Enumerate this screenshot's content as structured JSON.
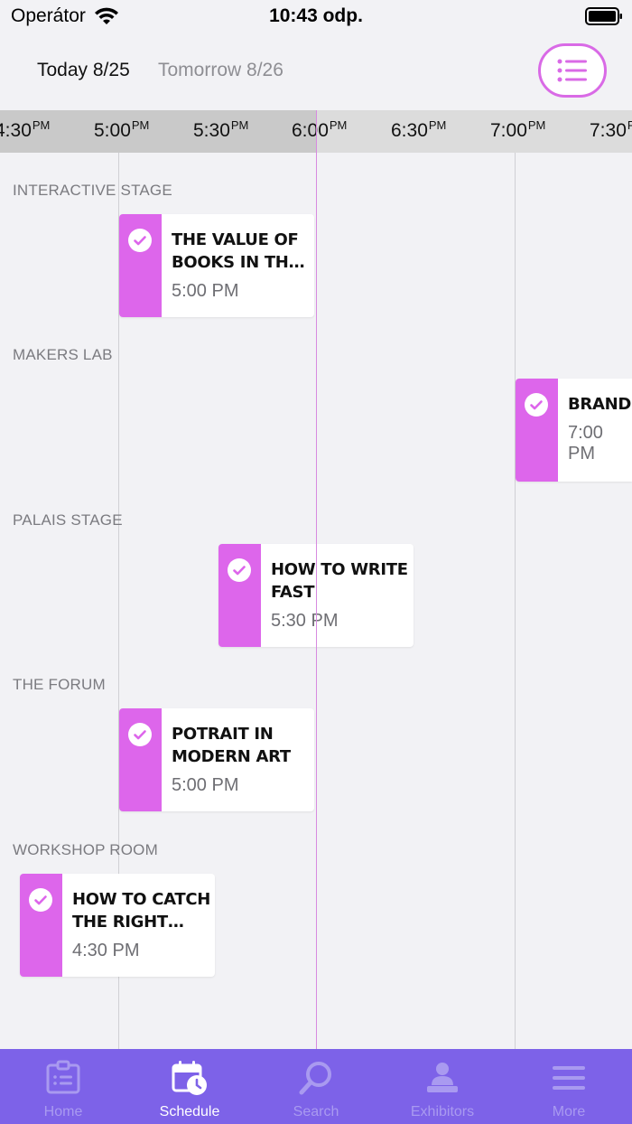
{
  "status_bar": {
    "carrier": "Operátor",
    "time": "10:43 odp."
  },
  "header": {
    "today_tab": "Today 8/25",
    "tomorrow_tab": "Tomorrow 8/26",
    "accent_color": "#d96ae6"
  },
  "timeline": {
    "labels": [
      {
        "time": "4:30",
        "suffix": "PM"
      },
      {
        "time": "5:00",
        "suffix": "PM"
      },
      {
        "time": "5:30",
        "suffix": "PM"
      },
      {
        "time": "6:00",
        "suffix": "PM"
      },
      {
        "time": "6:30",
        "suffix": "PM"
      },
      {
        "time": "7:00",
        "suffix": "PM"
      },
      {
        "time": "7:30",
        "suffix": "PM"
      }
    ]
  },
  "stages": [
    {
      "name": "INTERACTIVE STAGE"
    },
    {
      "name": "MAKERS LAB"
    },
    {
      "name": "PALAIS STAGE"
    },
    {
      "name": "THE FORUM"
    },
    {
      "name": "WORKSHOP ROOM"
    }
  ],
  "events": [
    {
      "title": "THE VALUE OF BOOKS IN THE DIGITAL AGE",
      "time": "5:00 PM",
      "stage": "INTERACTIVE STAGE"
    },
    {
      "title": "BRAND IDENTITY",
      "time": "7:00 PM",
      "stage": "MAKERS LAB"
    },
    {
      "title": "HOW TO WRITE FAST",
      "time": "5:30 PM",
      "stage": "PALAIS STAGE"
    },
    {
      "title": "POTRAIT IN MODERN ART",
      "time": "5:00 PM",
      "stage": "THE FORUM"
    },
    {
      "title": "HOW TO CATCH THE RIGHT MOMENT",
      "time": "4:30 PM",
      "stage": "WORKSHOP ROOM"
    }
  ],
  "event_color": "#dd66eb",
  "tab_bar": {
    "background": "#7d62e8",
    "tabs": [
      {
        "label": "Home",
        "icon": "home-icon"
      },
      {
        "label": "Schedule",
        "icon": "schedule-icon",
        "active": true
      },
      {
        "label": "Search",
        "icon": "search-icon"
      },
      {
        "label": "Exhibitors",
        "icon": "exhibitors-icon"
      },
      {
        "label": "More",
        "icon": "menu-icon"
      }
    ]
  }
}
